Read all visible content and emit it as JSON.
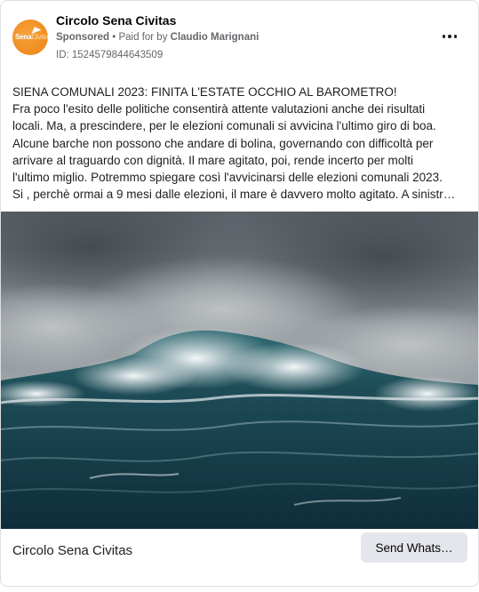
{
  "post": {
    "page_name": "Circolo Sena Civitas",
    "logo_text": {
      "main": "Sena",
      "accent": "Civitas"
    },
    "sponsored_label": "Sponsored",
    "separator": " • ",
    "paid_for_prefix": "Paid for by ",
    "paid_for_name": "Claudio Marignani",
    "ad_id": "ID: 1524579844643509",
    "more_icon": "more-horizontal-icon",
    "body_lines": [
      "SIENA COMUNALI 2023: FINITA L'ESTATE OCCHIO AL BAROMETRO!",
      "Fra poco l'esito delle politiche consentirà attente valutazioni anche dei risultati",
      "locali. Ma, a prescindere, per le elezioni comunali si avvicina l'ultimo giro di boa.",
      "Alcune barche non possono che andare di bolina, governando con difficoltà per",
      "arrivare al traguardo con dignità. Il mare agitato, poi, rende incerto per molti",
      "l'ultimo miglio. Potremmo spiegare così l'avvicinarsi delle elezioni comunali 2023.",
      "Si , perchè ormai a 9 mesi dalle elezioni, il mare è davvero molto agitato. A sinistr…"
    ],
    "image_subject": "stormy sea with large breaking wave under dark cloudy sky"
  },
  "footer": {
    "page_name": "Circolo Sena Civitas",
    "cta_label": "Send Whats…"
  },
  "colors": {
    "logo_orange": "#ef8c1e",
    "secondary_text": "#65676b",
    "button_bg": "#e4e6eb"
  }
}
